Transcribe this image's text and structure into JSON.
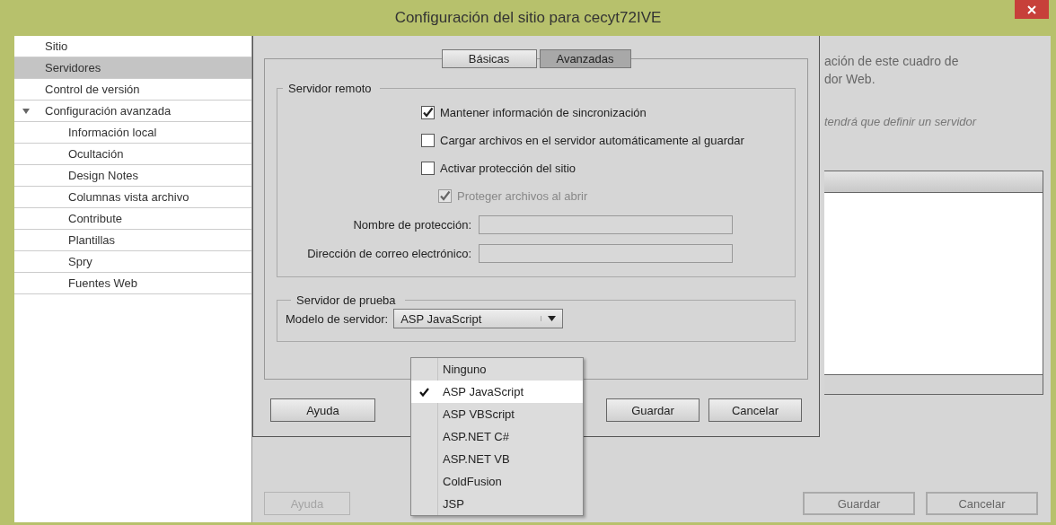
{
  "window": {
    "title": "Configuración del sitio para cecyt72IVE"
  },
  "sidebar": {
    "items": [
      {
        "label": "Sitio",
        "selected": false
      },
      {
        "label": "Servidores",
        "selected": true
      },
      {
        "label": "Control de versión",
        "selected": false
      },
      {
        "label": "Configuración avanzada",
        "selected": false,
        "expanded": true,
        "children": [
          {
            "label": "Información local",
            "selected": false
          },
          {
            "label": "Ocultación",
            "selected": false
          },
          {
            "label": "Design Notes",
            "selected": false
          },
          {
            "label": "Columnas vista archivo",
            "selected": false
          },
          {
            "label": "Contribute",
            "selected": false
          },
          {
            "label": "Plantillas",
            "selected": false
          },
          {
            "label": "Spry",
            "selected": false
          },
          {
            "label": "Fuentes Web",
            "selected": false
          }
        ]
      }
    ]
  },
  "background_panel": {
    "description_lines": [
      "ación de este cuadro de",
      "dor Web."
    ],
    "note": "tendrá que definir un servidor",
    "buttons": [
      {
        "label": "Ayuda",
        "disabled": true
      },
      {
        "label": "Guardar",
        "disabled": false
      },
      {
        "label": "Cancelar",
        "disabled": false
      }
    ]
  },
  "dialog": {
    "tabs": [
      {
        "label": "Básicas",
        "selected": false
      },
      {
        "label": "Avanzadas",
        "selected": true
      }
    ],
    "remote_server": {
      "title": "Servidor remoto",
      "options": [
        {
          "label": "Mantener información de sincronización",
          "checked": true,
          "disabled": false,
          "indented": false
        },
        {
          "label": "Cargar archivos en el servidor automáticamente al guardar",
          "checked": false,
          "disabled": false,
          "indented": false
        },
        {
          "label": "Activar protección del sitio",
          "checked": false,
          "disabled": false,
          "indented": false
        },
        {
          "label": "Proteger archivos al abrir",
          "checked": true,
          "disabled": true,
          "indented": true
        }
      ],
      "fields": [
        {
          "label": "Nombre de protección:",
          "disabled": true
        },
        {
          "label": "Dirección de correo electrónico:",
          "disabled": true
        }
      ]
    },
    "testing_server": {
      "title": "Servidor de prueba",
      "label": "Modelo de servidor:",
      "value": "ASP JavaScript",
      "dropdown": [
        {
          "label": "Ninguno",
          "selected": false
        },
        {
          "label": "ASP JavaScript",
          "selected": true
        },
        {
          "label": "ASP VBScript",
          "selected": false
        },
        {
          "label": "ASP.NET C#",
          "selected": false
        },
        {
          "label": "ASP.NET VB",
          "selected": false
        },
        {
          "label": "ColdFusion",
          "selected": false
        },
        {
          "label": "JSP",
          "selected": false
        }
      ]
    },
    "buttons": [
      "Ayuda",
      "Guardar",
      "Cancelar"
    ]
  }
}
